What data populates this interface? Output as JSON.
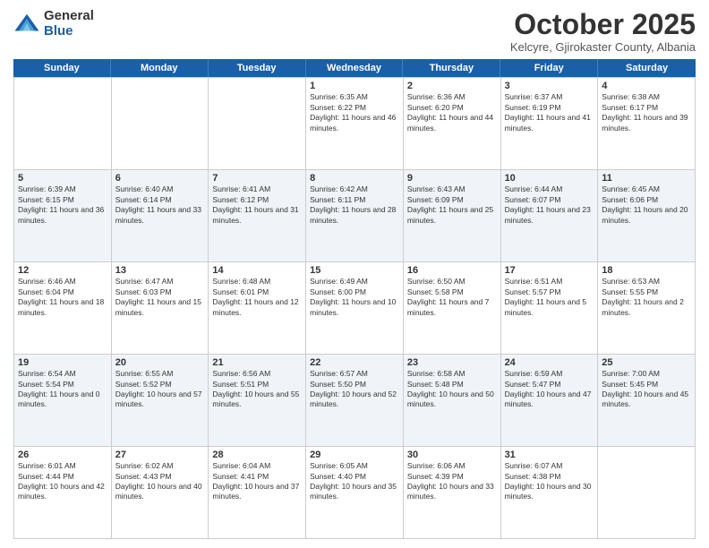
{
  "logo": {
    "general": "General",
    "blue": "Blue"
  },
  "title": "October 2025",
  "location": "Kelcyre, Gjirokaster County, Albania",
  "days_of_week": [
    "Sunday",
    "Monday",
    "Tuesday",
    "Wednesday",
    "Thursday",
    "Friday",
    "Saturday"
  ],
  "weeks": [
    [
      {
        "day": "",
        "text": ""
      },
      {
        "day": "",
        "text": ""
      },
      {
        "day": "",
        "text": ""
      },
      {
        "day": "1",
        "text": "Sunrise: 6:35 AM\nSunset: 6:22 PM\nDaylight: 11 hours and 46 minutes."
      },
      {
        "day": "2",
        "text": "Sunrise: 6:36 AM\nSunset: 6:20 PM\nDaylight: 11 hours and 44 minutes."
      },
      {
        "day": "3",
        "text": "Sunrise: 6:37 AM\nSunset: 6:19 PM\nDaylight: 11 hours and 41 minutes."
      },
      {
        "day": "4",
        "text": "Sunrise: 6:38 AM\nSunset: 6:17 PM\nDaylight: 11 hours and 39 minutes."
      }
    ],
    [
      {
        "day": "5",
        "text": "Sunrise: 6:39 AM\nSunset: 6:15 PM\nDaylight: 11 hours and 36 minutes."
      },
      {
        "day": "6",
        "text": "Sunrise: 6:40 AM\nSunset: 6:14 PM\nDaylight: 11 hours and 33 minutes."
      },
      {
        "day": "7",
        "text": "Sunrise: 6:41 AM\nSunset: 6:12 PM\nDaylight: 11 hours and 31 minutes."
      },
      {
        "day": "8",
        "text": "Sunrise: 6:42 AM\nSunset: 6:11 PM\nDaylight: 11 hours and 28 minutes."
      },
      {
        "day": "9",
        "text": "Sunrise: 6:43 AM\nSunset: 6:09 PM\nDaylight: 11 hours and 25 minutes."
      },
      {
        "day": "10",
        "text": "Sunrise: 6:44 AM\nSunset: 6:07 PM\nDaylight: 11 hours and 23 minutes."
      },
      {
        "day": "11",
        "text": "Sunrise: 6:45 AM\nSunset: 6:06 PM\nDaylight: 11 hours and 20 minutes."
      }
    ],
    [
      {
        "day": "12",
        "text": "Sunrise: 6:46 AM\nSunset: 6:04 PM\nDaylight: 11 hours and 18 minutes."
      },
      {
        "day": "13",
        "text": "Sunrise: 6:47 AM\nSunset: 6:03 PM\nDaylight: 11 hours and 15 minutes."
      },
      {
        "day": "14",
        "text": "Sunrise: 6:48 AM\nSunset: 6:01 PM\nDaylight: 11 hours and 12 minutes."
      },
      {
        "day": "15",
        "text": "Sunrise: 6:49 AM\nSunset: 6:00 PM\nDaylight: 11 hours and 10 minutes."
      },
      {
        "day": "16",
        "text": "Sunrise: 6:50 AM\nSunset: 5:58 PM\nDaylight: 11 hours and 7 minutes."
      },
      {
        "day": "17",
        "text": "Sunrise: 6:51 AM\nSunset: 5:57 PM\nDaylight: 11 hours and 5 minutes."
      },
      {
        "day": "18",
        "text": "Sunrise: 6:53 AM\nSunset: 5:55 PM\nDaylight: 11 hours and 2 minutes."
      }
    ],
    [
      {
        "day": "19",
        "text": "Sunrise: 6:54 AM\nSunset: 5:54 PM\nDaylight: 11 hours and 0 minutes."
      },
      {
        "day": "20",
        "text": "Sunrise: 6:55 AM\nSunset: 5:52 PM\nDaylight: 10 hours and 57 minutes."
      },
      {
        "day": "21",
        "text": "Sunrise: 6:56 AM\nSunset: 5:51 PM\nDaylight: 10 hours and 55 minutes."
      },
      {
        "day": "22",
        "text": "Sunrise: 6:57 AM\nSunset: 5:50 PM\nDaylight: 10 hours and 52 minutes."
      },
      {
        "day": "23",
        "text": "Sunrise: 6:58 AM\nSunset: 5:48 PM\nDaylight: 10 hours and 50 minutes."
      },
      {
        "day": "24",
        "text": "Sunrise: 6:59 AM\nSunset: 5:47 PM\nDaylight: 10 hours and 47 minutes."
      },
      {
        "day": "25",
        "text": "Sunrise: 7:00 AM\nSunset: 5:45 PM\nDaylight: 10 hours and 45 minutes."
      }
    ],
    [
      {
        "day": "26",
        "text": "Sunrise: 6:01 AM\nSunset: 4:44 PM\nDaylight: 10 hours and 42 minutes."
      },
      {
        "day": "27",
        "text": "Sunrise: 6:02 AM\nSunset: 4:43 PM\nDaylight: 10 hours and 40 minutes."
      },
      {
        "day": "28",
        "text": "Sunrise: 6:04 AM\nSunset: 4:41 PM\nDaylight: 10 hours and 37 minutes."
      },
      {
        "day": "29",
        "text": "Sunrise: 6:05 AM\nSunset: 4:40 PM\nDaylight: 10 hours and 35 minutes."
      },
      {
        "day": "30",
        "text": "Sunrise: 6:06 AM\nSunset: 4:39 PM\nDaylight: 10 hours and 33 minutes."
      },
      {
        "day": "31",
        "text": "Sunrise: 6:07 AM\nSunset: 4:38 PM\nDaylight: 10 hours and 30 minutes."
      },
      {
        "day": "",
        "text": ""
      }
    ]
  ]
}
